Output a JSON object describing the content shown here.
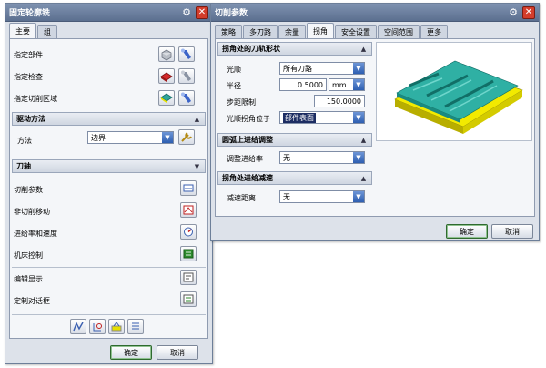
{
  "left_dialog": {
    "title": "固定轮廓铣",
    "tabs": [
      "主要",
      "组"
    ],
    "rows": {
      "part": "指定部件",
      "check": "指定检查",
      "cut_area": "指定切削区域"
    },
    "drive_method": {
      "header": "驱动方法",
      "method_label": "方法",
      "method_value": "边界"
    },
    "tool_axis_header": "刀轴",
    "items": [
      "切削参数",
      "非切削移动",
      "进给率和速度",
      "机床控制",
      "编辑显示",
      "定制对话框"
    ],
    "ok": "确定",
    "cancel": "取消"
  },
  "right_dialog": {
    "title": "切削参数",
    "tabs": [
      "策略",
      "多刀路",
      "余量",
      "拐角",
      "安全设置",
      "空间范围",
      "更多"
    ],
    "active_tab": "拐角",
    "corner_group": {
      "header": "拐角处的刀轨形状",
      "smooth_label": "光顺",
      "smooth_value": "所有刀路",
      "radius_label": "半径",
      "radius_value": "0.5000",
      "radius_unit": "mm",
      "step_limit_label": "步距限制",
      "step_limit_value": "150.0000",
      "corner_pos_label": "光顺拐角位于",
      "corner_pos_value": "部件表面"
    },
    "arc_feed_group": {
      "header": "圆弧上进给调整",
      "label": "调整进给率",
      "value": "无"
    },
    "slowdown_group": {
      "header": "拐角处进给减速",
      "label": "减速距离",
      "value": "无"
    },
    "ok": "确定",
    "cancel": "取消"
  },
  "colors": {
    "titlebar": "#6a7ea0",
    "close": "#d33d2b",
    "preview_part": "#2fa59a",
    "preview_base": "#e6e000"
  }
}
